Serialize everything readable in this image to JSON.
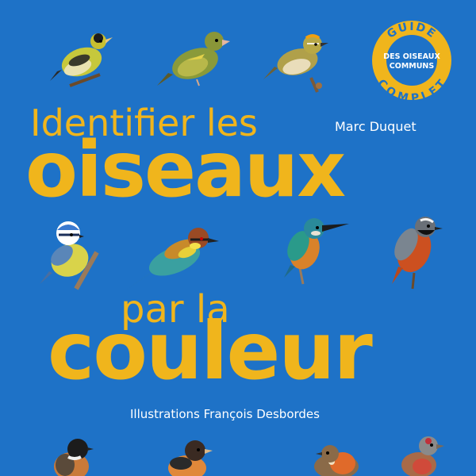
{
  "cover": {
    "title_line1": "Identifier les",
    "title_line2": "oiseaux",
    "title_line3": "par la",
    "title_line4": "couleur",
    "author": "Marc Duquet",
    "illustrator": "Illustrations François Desbordes",
    "badge": {
      "top_word": "GUIDE",
      "middle_line1": "DES OISEAUX",
      "middle_line2": "COMMUNS",
      "bottom_word": "COMPLET"
    }
  },
  "colors": {
    "background": "#1e72c7",
    "title": "#f0b51c",
    "text": "#ffffff",
    "badge_ring": "#f0b51c"
  },
  "icons": [
    "siskin-illustration",
    "greenfinch-illustration",
    "firecrest-illustration",
    "blue-tit-illustration",
    "bee-eater-illustration",
    "kingfisher-illustration",
    "redstart-illustration",
    "stonechat-illustration",
    "brambling-illustration",
    "robin-illustration",
    "linnet-illustration"
  ]
}
